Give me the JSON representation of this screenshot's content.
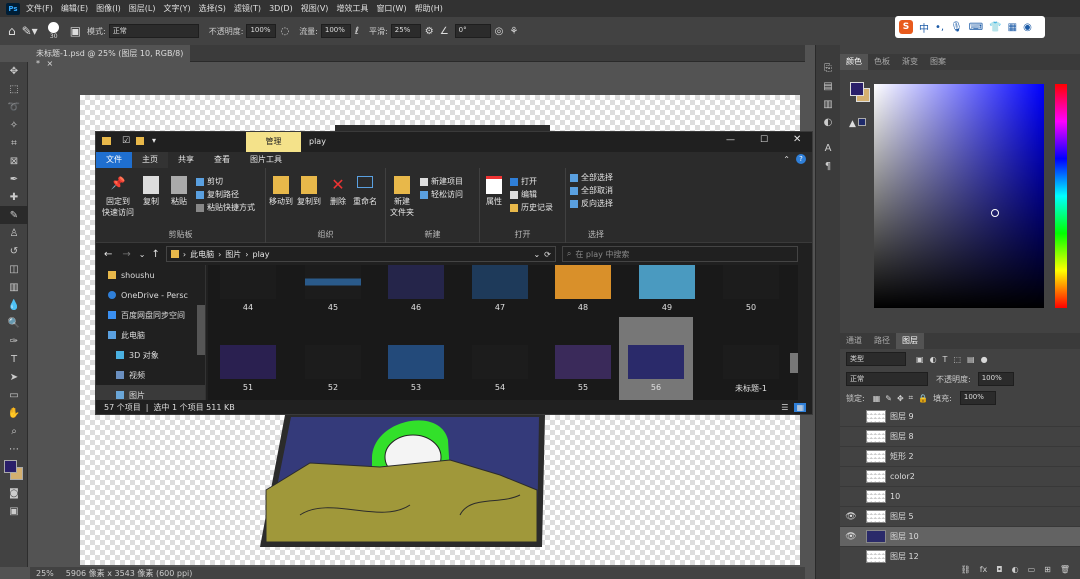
{
  "menubar": {
    "items": [
      "文件(F)",
      "编辑(E)",
      "图像(I)",
      "图层(L)",
      "文字(Y)",
      "选择(S)",
      "滤镜(T)",
      "3D(D)",
      "视图(V)",
      "增效工具",
      "窗口(W)",
      "帮助(H)"
    ]
  },
  "options": {
    "brush_size": "30",
    "mode_label": "模式:",
    "mode_value": "正常",
    "opacity_label": "不透明度:",
    "opacity_value": "100%",
    "flow_label": "流量:",
    "flow_value": "100%",
    "smooth_label": "平滑:",
    "smooth_value": "25%",
    "angle_value": "0°"
  },
  "document": {
    "tab_title": "未标题-1.psd @ 25% (图层 10, RGB/8) *"
  },
  "statusbar": {
    "zoom": "25%",
    "info": "5906 像素 x 3543 像素 (600 ppi)"
  },
  "ime": {
    "label": "中"
  },
  "color_panel": {
    "tabs": [
      "颜色",
      "色板",
      "渐变",
      "图案"
    ],
    "fg_color": "#2a1f6a",
    "bg_color": "#d4b070"
  },
  "layers_panel": {
    "tabs": [
      "通道",
      "路径",
      "图层"
    ],
    "filter_label": "类型",
    "blend_mode": "正常",
    "opacity_label": "不透明度:",
    "opacity_value": "100%",
    "lock_label": "锁定:",
    "fill_label": "填充:",
    "fill_value": "100%",
    "layers": [
      {
        "name": "图层 9",
        "visible": false,
        "selected": false
      },
      {
        "name": "图层 8",
        "visible": false,
        "selected": false
      },
      {
        "name": "矩形 2",
        "visible": false,
        "selected": false
      },
      {
        "name": "color2",
        "visible": false,
        "selected": false
      },
      {
        "name": "10",
        "visible": false,
        "selected": false
      },
      {
        "name": "图层 5",
        "visible": true,
        "selected": false
      },
      {
        "name": "图层 10",
        "visible": true,
        "selected": true
      },
      {
        "name": "图层 12",
        "visible": false,
        "selected": false
      }
    ],
    "footer_icons": [
      "link-icon",
      "fx-icon",
      "mask-icon",
      "adjustment-icon",
      "folder-icon",
      "new-layer-icon",
      "trash-icon"
    ]
  },
  "explorer": {
    "context_tab": "管理",
    "window_title": "play",
    "ribbon_tabs": [
      "文件",
      "主页",
      "共享",
      "查看",
      "图片工具"
    ],
    "clipboard": {
      "pin": "固定到\n快速访问",
      "copy": "复制",
      "paste": "粘贴",
      "cut": "剪切",
      "copy_path": "复制路径",
      "paste_shortcut": "粘贴快捷方式",
      "group": "剪贴板"
    },
    "organize": {
      "move_to": "移动到",
      "copy_to": "复制到",
      "delete": "删除",
      "rename": "重命名",
      "group": "组织"
    },
    "new": {
      "new_folder": "新建\n文件夹",
      "new_item": "新建项目",
      "easy_access": "轻松访问",
      "group": "新建"
    },
    "open": {
      "properties": "属性",
      "open": "打开",
      "edit": "编辑",
      "history": "历史记录",
      "group": "打开"
    },
    "select": {
      "select_all": "全部选择",
      "select_none": "全部取消",
      "invert": "反向选择",
      "group": "选择"
    },
    "address": {
      "crumbs": [
        "此电脑",
        "图片",
        "play"
      ],
      "search_placeholder": "在 play 中搜索"
    },
    "nav": [
      {
        "label": "shoushu",
        "color": "#e8b84a"
      },
      {
        "label": "OneDrive - Persc",
        "color": "#2f7fd8"
      },
      {
        "label": "百度网盘同步空间",
        "color": "#3a8ff0"
      },
      {
        "label": "此电脑",
        "color": "#5aa0e0"
      },
      {
        "label": "3D 对象",
        "color": "#4ab0e0"
      },
      {
        "label": "视频",
        "color": "#6a8fc0"
      },
      {
        "label": "图片",
        "color": "#6aa6d8"
      }
    ],
    "files_row1": [
      "44",
      "45",
      "46",
      "47",
      "48",
      "49",
      "50"
    ],
    "files_row2": [
      "51",
      "52",
      "53",
      "54",
      "55",
      "56",
      "未标题-1"
    ],
    "status_count": "57 个项目",
    "status_selected": "选中 1 个项目  511 KB"
  }
}
